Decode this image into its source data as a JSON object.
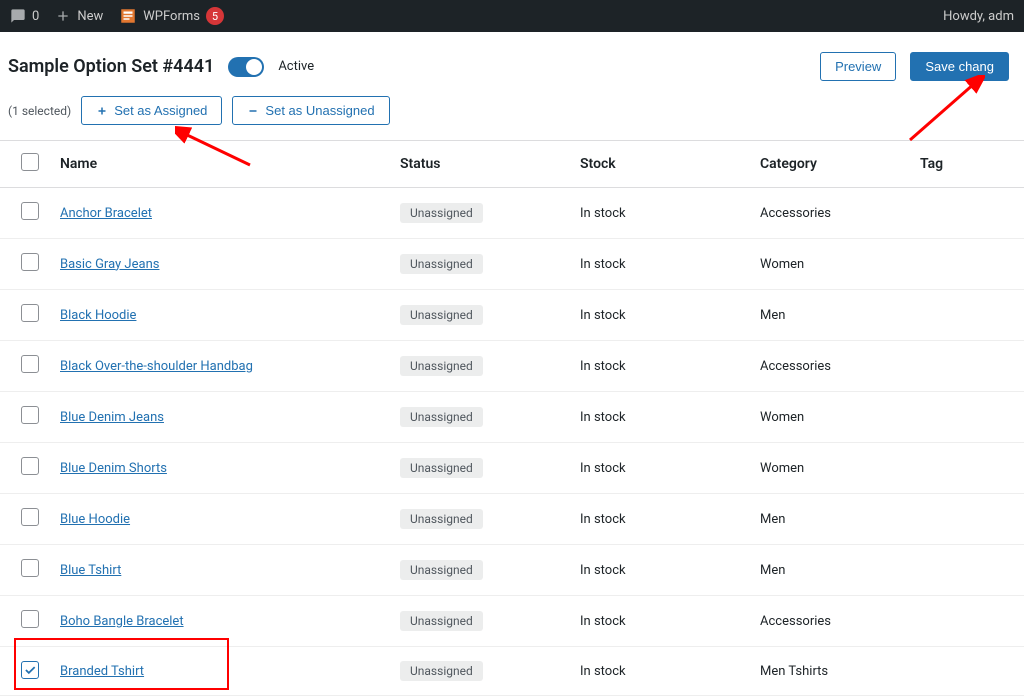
{
  "adminBar": {
    "comments": "0",
    "new": "New",
    "wpforms": "WPForms",
    "wpformsCount": "5",
    "howdy": "Howdy, adm"
  },
  "header": {
    "title": "Sample Option Set #4441",
    "activeLabel": "Active",
    "preview": "Preview",
    "saveChanges": "Save chang"
  },
  "bulk": {
    "selectedCount": "(1 selected)",
    "setAssigned": "Set as Assigned",
    "setUnassigned": "Set as Unassigned"
  },
  "table": {
    "headers": {
      "name": "Name",
      "status": "Status",
      "stock": "Stock",
      "category": "Category",
      "tag": "Tag"
    },
    "rows": [
      {
        "name": "Anchor Bracelet",
        "status": "Unassigned",
        "stock": "In stock",
        "category": "Accessories",
        "checked": false
      },
      {
        "name": "Basic Gray Jeans",
        "status": "Unassigned",
        "stock": "In stock",
        "category": "Women",
        "checked": false
      },
      {
        "name": "Black Hoodie",
        "status": "Unassigned",
        "stock": "In stock",
        "category": "Men",
        "checked": false
      },
      {
        "name": "Black Over-the-shoulder Handbag",
        "status": "Unassigned",
        "stock": "In stock",
        "category": "Accessories",
        "checked": false
      },
      {
        "name": "Blue Denim Jeans",
        "status": "Unassigned",
        "stock": "In stock",
        "category": "Women",
        "checked": false
      },
      {
        "name": "Blue Denim Shorts",
        "status": "Unassigned",
        "stock": "In stock",
        "category": "Women",
        "checked": false
      },
      {
        "name": "Blue Hoodie",
        "status": "Unassigned",
        "stock": "In stock",
        "category": "Men",
        "checked": false
      },
      {
        "name": "Blue Tshirt",
        "status": "Unassigned",
        "stock": "In stock",
        "category": "Men",
        "checked": false
      },
      {
        "name": "Boho Bangle Bracelet",
        "status": "Unassigned",
        "stock": "In stock",
        "category": "Accessories",
        "checked": false
      },
      {
        "name": "Branded Tshirt",
        "status": "Unassigned",
        "stock": "In stock",
        "category": "Men Tshirts",
        "checked": true
      }
    ]
  }
}
